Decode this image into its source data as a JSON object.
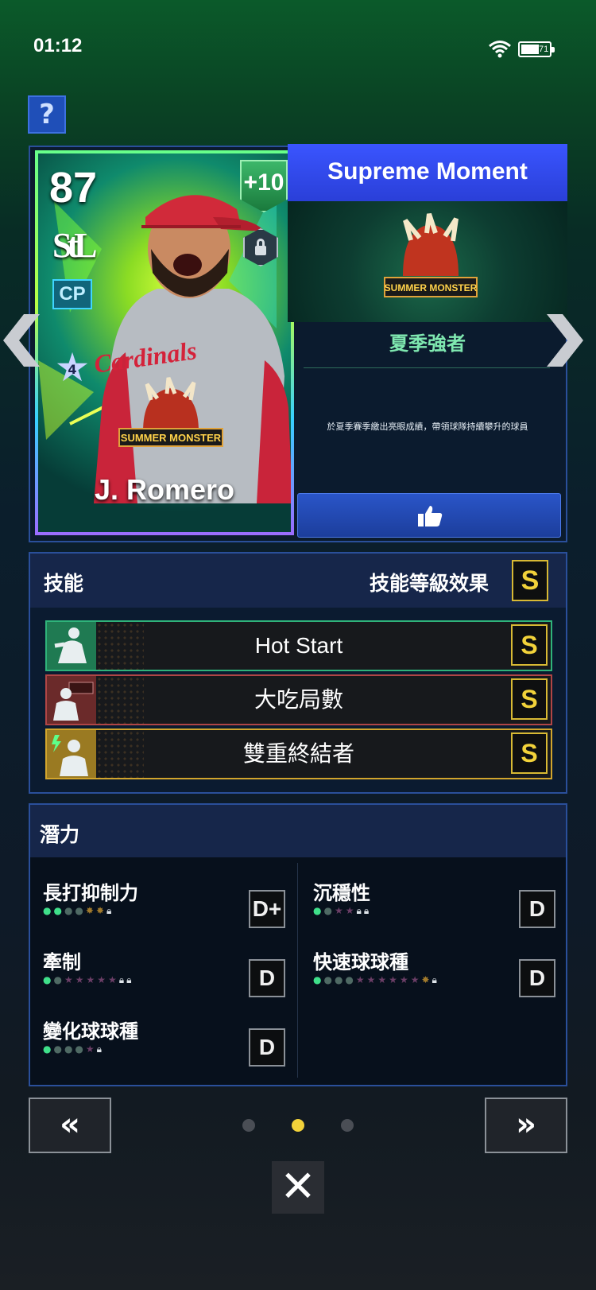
{
  "status": {
    "time": "01:12",
    "battery": "71"
  },
  "help": {
    "label": "?"
  },
  "card": {
    "rating": "87",
    "plus": "+10",
    "team_logo": "StL",
    "position": "CP",
    "stars": "4",
    "jersey_text": "Cardinals",
    "event_logo": "SUMMER MONSTER",
    "name": "J. Romero"
  },
  "moment": {
    "header": "Supreme Moment",
    "logo_text": "SUMMER MONSTER",
    "title": "夏季強者",
    "description": "於夏季賽季繳出亮眼成績，帶領球隊持續攀升的球員"
  },
  "skills": {
    "title": "技能",
    "effect_label": "技能等級效果",
    "effect_grade": "S",
    "items": [
      {
        "name": "Hot Start",
        "grade": "S",
        "color": "#2fb37a"
      },
      {
        "name": "大吃局數",
        "grade": "S",
        "color": "#b04545"
      },
      {
        "name": "雙重終結者",
        "grade": "S",
        "color": "#d2a52c"
      }
    ]
  },
  "potential": {
    "title": "潛力",
    "items": [
      {
        "label": "長打抑制力",
        "grade": "D+"
      },
      {
        "label": "沉穩性",
        "grade": "D"
      },
      {
        "label": "牽制",
        "grade": "D"
      },
      {
        "label": "快速球球種",
        "grade": "D"
      },
      {
        "label": "變化球球種",
        "grade": "D"
      }
    ]
  },
  "pager": {
    "prev": "«",
    "next": "»",
    "close": "✕"
  },
  "colors": {
    "accent": "#f2d23a",
    "panel_border": "#2a4f9a",
    "header_blue": "#3a55ff"
  }
}
